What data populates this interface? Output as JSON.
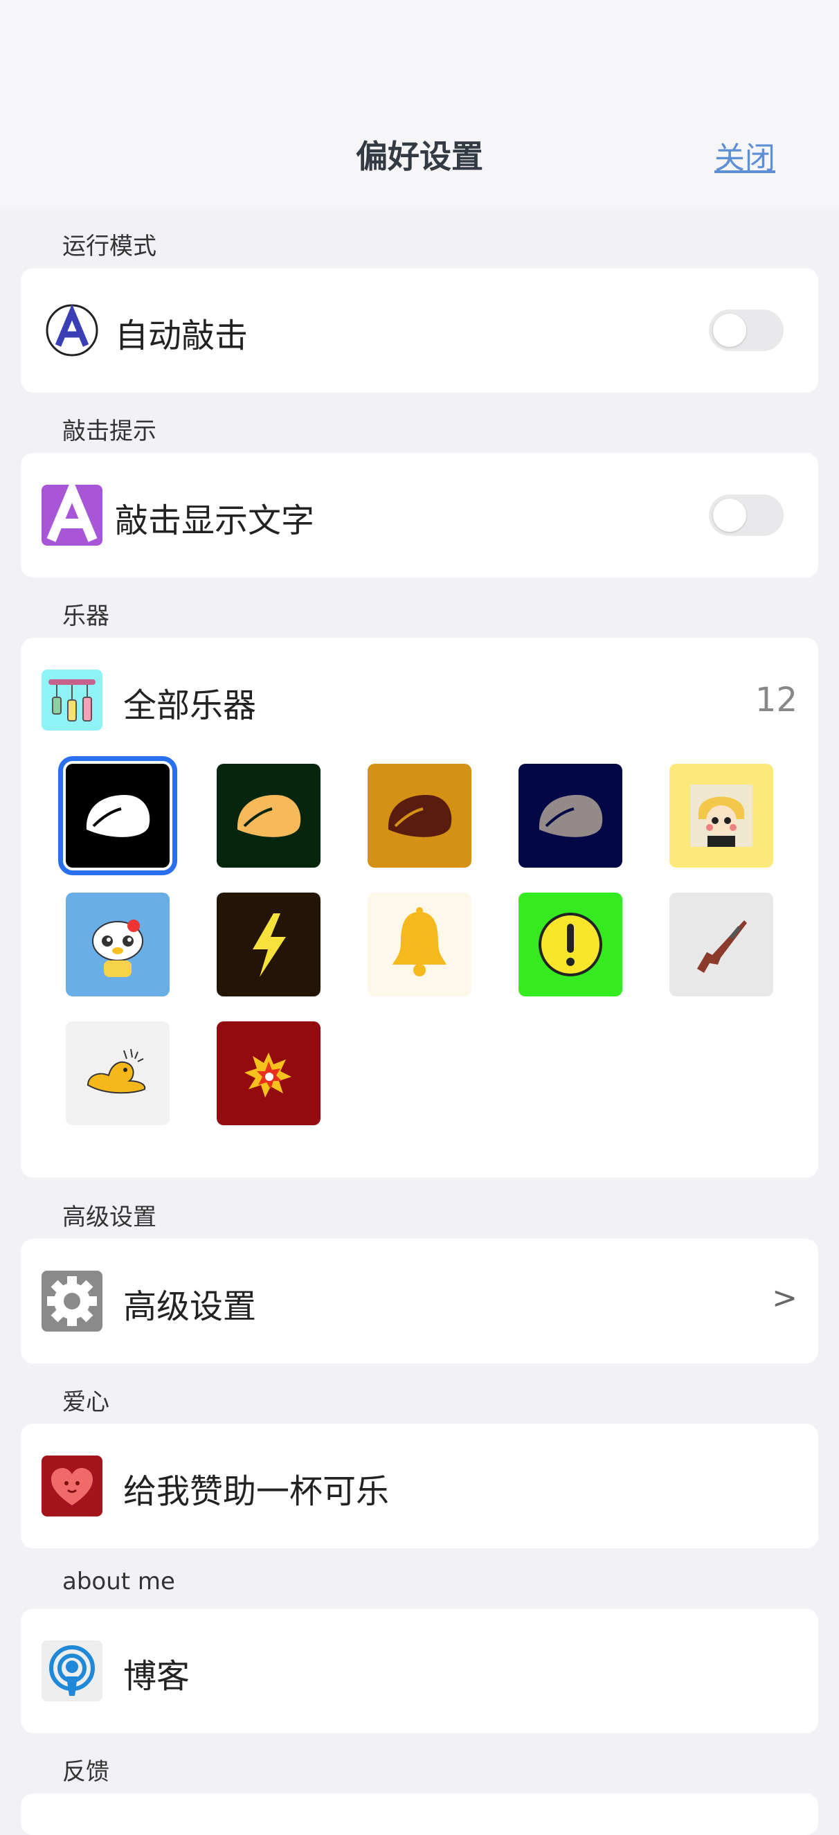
{
  "header": {
    "title": "偏好设置",
    "close_label": "关闭"
  },
  "sections": {
    "run_mode": {
      "label": "运行模式",
      "item": "自动敲击",
      "toggle_on": false
    },
    "hint": {
      "label": "敲击提示",
      "item": "敲击显示文字",
      "toggle_on": false
    },
    "instruments": {
      "label": "乐器",
      "item": "全部乐器",
      "count": "12",
      "icons": [
        {
          "name": "woodfish-white-icon",
          "bg": "#000000",
          "selected": true
        },
        {
          "name": "woodfish-orange-icon",
          "bg": "#05260d"
        },
        {
          "name": "woodfish-brown-icon",
          "bg": "#d49114"
        },
        {
          "name": "woodfish-gray-icon",
          "bg": "#020846"
        },
        {
          "name": "anime-character-icon",
          "bg": "#fce97a"
        },
        {
          "name": "hello-kitty-icon",
          "bg": "#6aaee8"
        },
        {
          "name": "lightning-icon",
          "bg": "#241405"
        },
        {
          "name": "bell-icon",
          "bg": "#fdf8ea"
        },
        {
          "name": "warning-icon",
          "bg": "#35ea1e"
        },
        {
          "name": "rifle-icon",
          "bg": "#e8e8e8"
        },
        {
          "name": "yellow-duck-icon",
          "bg": "#f1f1f1"
        },
        {
          "name": "explosion-icon",
          "bg": "#930b0e"
        }
      ]
    },
    "advanced": {
      "label": "高级设置",
      "item": "高级设置",
      "chevron": ">"
    },
    "love": {
      "label": "爱心",
      "item": "给我赞助一杯可乐"
    },
    "about": {
      "label": "about me",
      "item": "博客"
    },
    "feedback": {
      "label": "反馈"
    }
  }
}
